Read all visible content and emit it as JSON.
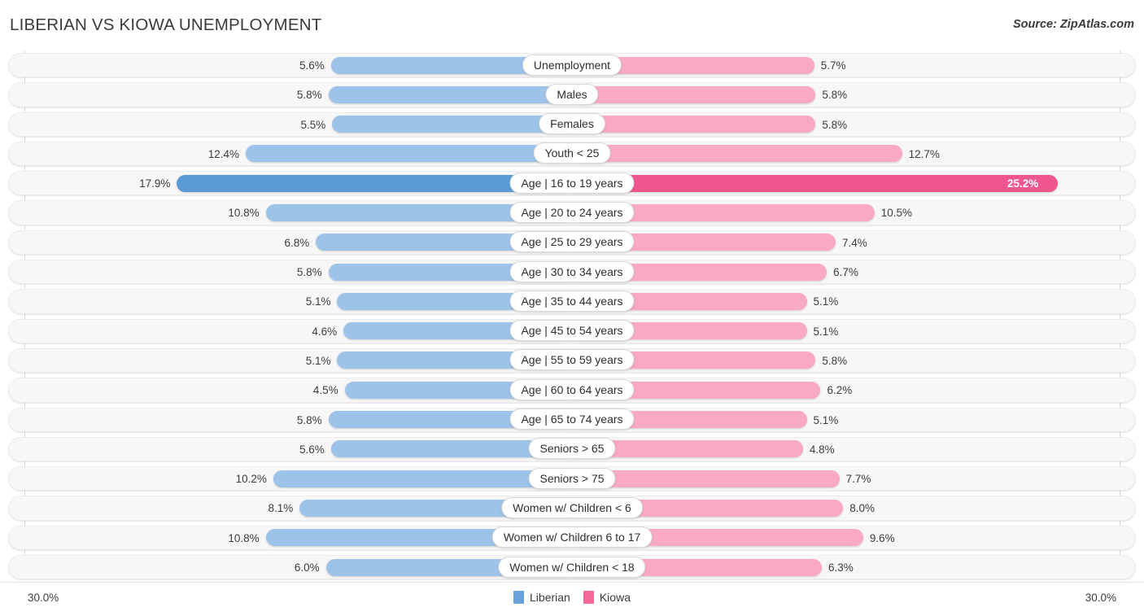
{
  "header": {
    "title": "LIBERIAN VS KIOWA UNEMPLOYMENT",
    "source": "Source: ZipAtlas.com"
  },
  "footer": {
    "axis_min_label": "30.0%",
    "axis_max_label": "30.0%",
    "legend": [
      {
        "name": "legend-liberian",
        "label": "Liberian",
        "color": "#6AA3DC"
      },
      {
        "name": "legend-kiowa",
        "label": "Kiowa",
        "color": "#F4689A"
      }
    ]
  },
  "colors": {
    "left_normal": "#9DC3E9",
    "right_normal": "#F9A8C5",
    "left_highlight": "#5B9BD5",
    "right_highlight": "#F0568E",
    "track": "#f7f7f7",
    "gridline": "#d8d8d8",
    "text": "#3c3c3c"
  },
  "chart_data": {
    "type": "bar",
    "subtype": "diverging-bidirectional",
    "title": "LIBERIAN VS KIOWA UNEMPLOYMENT",
    "xlabel": "",
    "ylabel": "",
    "xlim": [
      -30.0,
      30.0
    ],
    "axis_min": 30.0,
    "axis_max": 30.0,
    "grid": true,
    "legend_position": "bottom-center",
    "categories": [
      "Unemployment",
      "Males",
      "Females",
      "Youth < 25",
      "Age | 16 to 19 years",
      "Age | 20 to 24 years",
      "Age | 25 to 29 years",
      "Age | 30 to 34 years",
      "Age | 35 to 44 years",
      "Age | 45 to 54 years",
      "Age | 55 to 59 years",
      "Age | 60 to 64 years",
      "Age | 65 to 74 years",
      "Seniors > 65",
      "Seniors > 75",
      "Women w/ Children < 6",
      "Women w/ Children 6 to 17",
      "Women w/ Children < 18"
    ],
    "series": [
      {
        "name": "Liberian",
        "side": "left",
        "color": "#9DC3E9",
        "values": [
          5.6,
          5.8,
          5.5,
          12.4,
          17.9,
          10.8,
          6.8,
          5.8,
          5.1,
          4.6,
          5.1,
          4.5,
          5.8,
          5.6,
          10.2,
          8.1,
          10.8,
          6.0
        ],
        "labels": [
          "5.6%",
          "5.8%",
          "5.5%",
          "12.4%",
          "17.9%",
          "10.8%",
          "6.8%",
          "5.8%",
          "5.1%",
          "4.6%",
          "5.1%",
          "4.5%",
          "5.8%",
          "5.6%",
          "10.2%",
          "8.1%",
          "10.8%",
          "6.0%"
        ]
      },
      {
        "name": "Kiowa",
        "side": "right",
        "color": "#F9A8C5",
        "values": [
          5.7,
          5.8,
          5.8,
          12.7,
          25.2,
          10.5,
          7.4,
          6.7,
          5.1,
          5.1,
          5.8,
          6.2,
          5.1,
          4.8,
          7.7,
          8.0,
          9.6,
          6.3
        ],
        "labels": [
          "5.7%",
          "5.8%",
          "5.8%",
          "12.7%",
          "25.2%",
          "10.5%",
          "7.4%",
          "6.7%",
          "5.1%",
          "5.1%",
          "5.8%",
          "6.2%",
          "5.1%",
          "4.8%",
          "7.7%",
          "8.0%",
          "9.6%",
          "6.3%"
        ]
      }
    ],
    "highlighted_row_index": 4
  }
}
